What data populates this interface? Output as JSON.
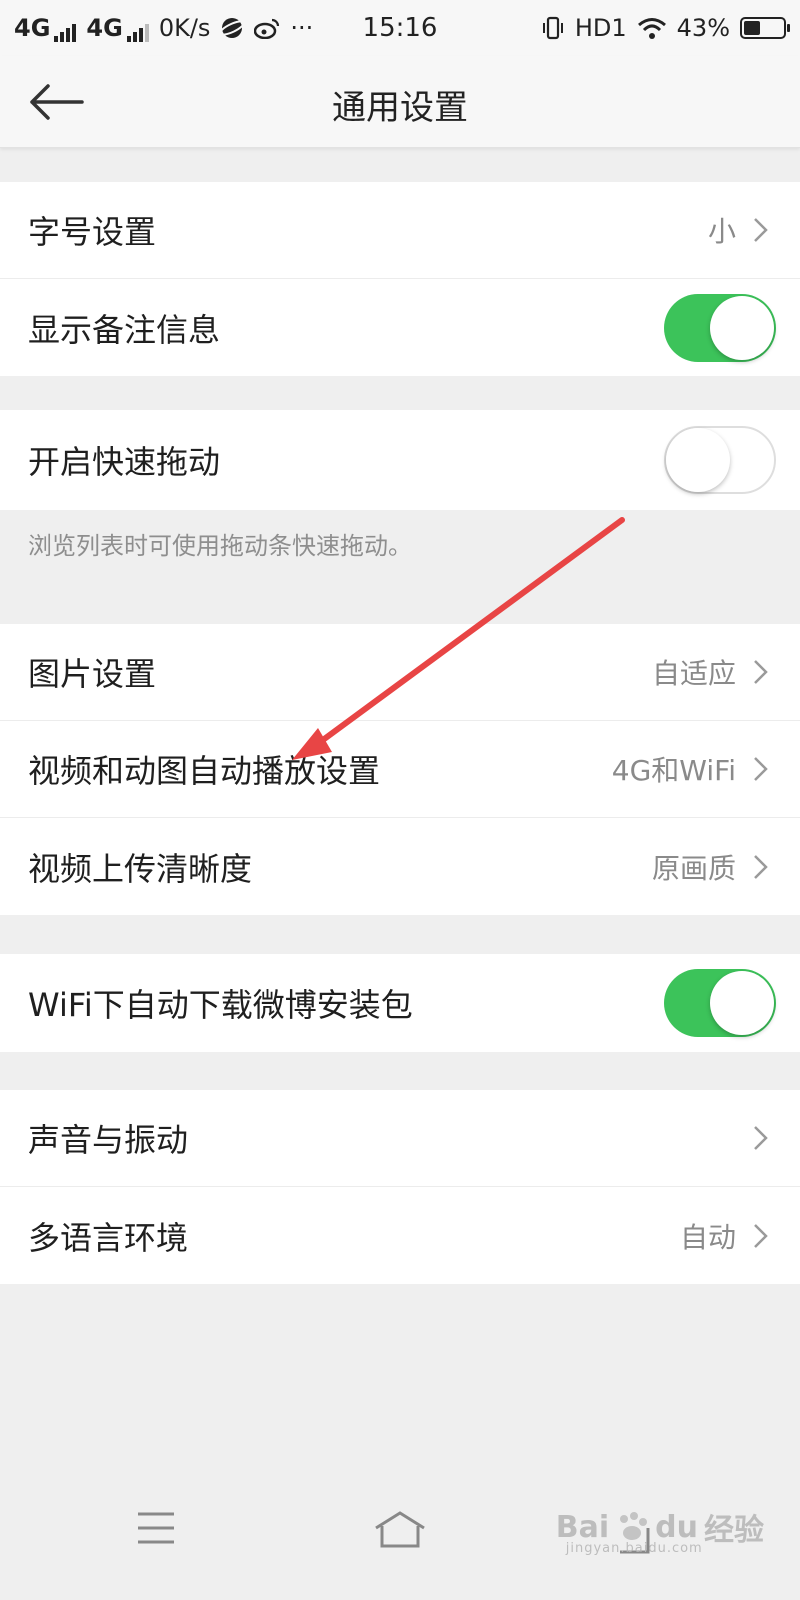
{
  "status_bar": {
    "network_1": "4G",
    "network_2": "4G",
    "speed": "0K/s",
    "extra": "···",
    "time": "15:16",
    "hd_label": "HD1",
    "battery": "43%",
    "battery_level": 0.43
  },
  "header": {
    "title": "通用设置"
  },
  "groups": {
    "g1": {
      "font_size": {
        "label": "字号设置",
        "value": "小"
      },
      "show_remark": {
        "label": "显示备注信息",
        "toggle_on": true
      }
    },
    "g2": {
      "fast_drag": {
        "label": "开启快速拖动",
        "toggle_on": false
      },
      "hint": "浏览列表时可使用拖动条快速拖动。"
    },
    "g3": {
      "image_settings": {
        "label": "图片设置",
        "value": "自适应"
      },
      "autoplay": {
        "label": "视频和动图自动播放设置",
        "value": "4G和WiFi"
      },
      "upload_quality": {
        "label": "视频上传清晰度",
        "value": "原画质"
      }
    },
    "g4": {
      "wifi_download": {
        "label": "WiFi下自动下载微博安装包",
        "toggle_on": true
      }
    },
    "g5": {
      "sound_vibration": {
        "label": "声音与振动"
      },
      "language": {
        "label": "多语言环境",
        "value": "自动"
      }
    }
  },
  "watermark": {
    "brand": "Bai",
    "brand_2": "du",
    "brand_3": "经验",
    "url": "jingyan.baidu.com"
  },
  "colors": {
    "toggle_on": "#3cc35a",
    "annotation_arrow": "#e84545"
  }
}
